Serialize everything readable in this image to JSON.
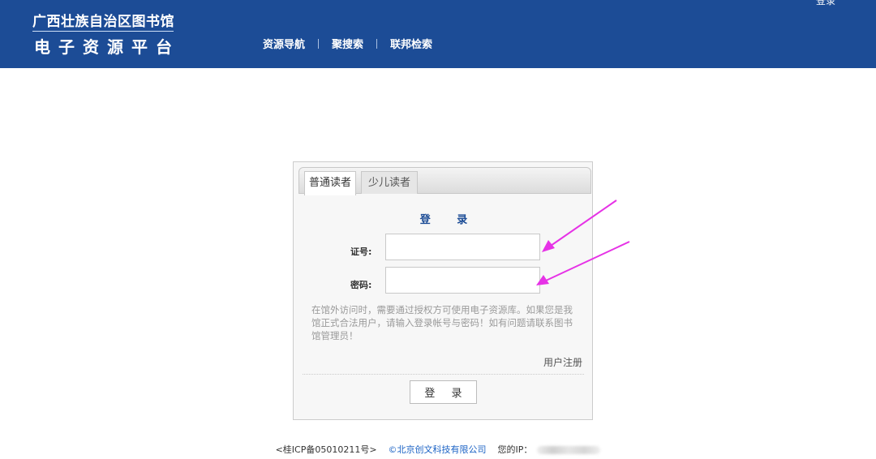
{
  "header": {
    "logo_line1": "广西壮族自治区图书馆",
    "logo_line2": "电子资源平台",
    "nav": [
      "资源导航",
      "聚搜索",
      "联邦检索"
    ],
    "top_login": "登录",
    "bg_color": "#1c4c96"
  },
  "login": {
    "tabs": [
      "普通读者",
      "少儿读者"
    ],
    "active_tab": "普通读者",
    "title": "登 录",
    "fields": {
      "card_label": "证号:",
      "card_value": "",
      "password_label": "密码:",
      "password_value": ""
    },
    "notice": "在馆外访问时，需要通过授权方可使用电子资源库。如果您是我馆正式合法用户，请输入登录帐号与密码！如有问题请联系图书馆管理员！",
    "register_link": "用户注册",
    "submit_label": "登 录"
  },
  "annotation": {
    "arrow_color": "#e632e6"
  },
  "footer": {
    "icp": "<桂ICP备05010211号>",
    "company": "©北京创文科技有限公司",
    "ip_label": "您的IP：",
    "link_color": "#1c63c5"
  }
}
